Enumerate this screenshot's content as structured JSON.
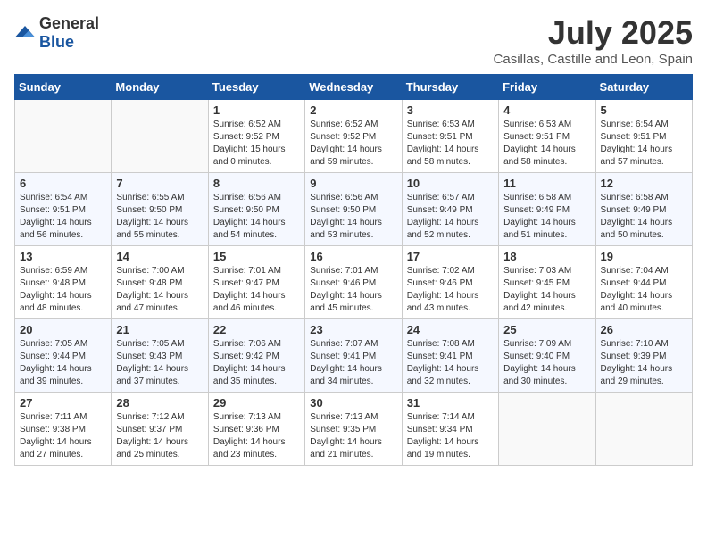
{
  "header": {
    "logo_general": "General",
    "logo_blue": "Blue",
    "month_title": "July 2025",
    "location": "Casillas, Castille and Leon, Spain"
  },
  "days_of_week": [
    "Sunday",
    "Monday",
    "Tuesday",
    "Wednesday",
    "Thursday",
    "Friday",
    "Saturday"
  ],
  "weeks": [
    [
      {
        "day": "",
        "info": ""
      },
      {
        "day": "",
        "info": ""
      },
      {
        "day": "1",
        "sunrise": "6:52 AM",
        "sunset": "9:52 PM",
        "daylight": "15 hours and 0 minutes."
      },
      {
        "day": "2",
        "sunrise": "6:52 AM",
        "sunset": "9:52 PM",
        "daylight": "14 hours and 59 minutes."
      },
      {
        "day": "3",
        "sunrise": "6:53 AM",
        "sunset": "9:51 PM",
        "daylight": "14 hours and 58 minutes."
      },
      {
        "day": "4",
        "sunrise": "6:53 AM",
        "sunset": "9:51 PM",
        "daylight": "14 hours and 58 minutes."
      },
      {
        "day": "5",
        "sunrise": "6:54 AM",
        "sunset": "9:51 PM",
        "daylight": "14 hours and 57 minutes."
      }
    ],
    [
      {
        "day": "6",
        "sunrise": "6:54 AM",
        "sunset": "9:51 PM",
        "daylight": "14 hours and 56 minutes."
      },
      {
        "day": "7",
        "sunrise": "6:55 AM",
        "sunset": "9:50 PM",
        "daylight": "14 hours and 55 minutes."
      },
      {
        "day": "8",
        "sunrise": "6:56 AM",
        "sunset": "9:50 PM",
        "daylight": "14 hours and 54 minutes."
      },
      {
        "day": "9",
        "sunrise": "6:56 AM",
        "sunset": "9:50 PM",
        "daylight": "14 hours and 53 minutes."
      },
      {
        "day": "10",
        "sunrise": "6:57 AM",
        "sunset": "9:49 PM",
        "daylight": "14 hours and 52 minutes."
      },
      {
        "day": "11",
        "sunrise": "6:58 AM",
        "sunset": "9:49 PM",
        "daylight": "14 hours and 51 minutes."
      },
      {
        "day": "12",
        "sunrise": "6:58 AM",
        "sunset": "9:49 PM",
        "daylight": "14 hours and 50 minutes."
      }
    ],
    [
      {
        "day": "13",
        "sunrise": "6:59 AM",
        "sunset": "9:48 PM",
        "daylight": "14 hours and 48 minutes."
      },
      {
        "day": "14",
        "sunrise": "7:00 AM",
        "sunset": "9:48 PM",
        "daylight": "14 hours and 47 minutes."
      },
      {
        "day": "15",
        "sunrise": "7:01 AM",
        "sunset": "9:47 PM",
        "daylight": "14 hours and 46 minutes."
      },
      {
        "day": "16",
        "sunrise": "7:01 AM",
        "sunset": "9:46 PM",
        "daylight": "14 hours and 45 minutes."
      },
      {
        "day": "17",
        "sunrise": "7:02 AM",
        "sunset": "9:46 PM",
        "daylight": "14 hours and 43 minutes."
      },
      {
        "day": "18",
        "sunrise": "7:03 AM",
        "sunset": "9:45 PM",
        "daylight": "14 hours and 42 minutes."
      },
      {
        "day": "19",
        "sunrise": "7:04 AM",
        "sunset": "9:44 PM",
        "daylight": "14 hours and 40 minutes."
      }
    ],
    [
      {
        "day": "20",
        "sunrise": "7:05 AM",
        "sunset": "9:44 PM",
        "daylight": "14 hours and 39 minutes."
      },
      {
        "day": "21",
        "sunrise": "7:05 AM",
        "sunset": "9:43 PM",
        "daylight": "14 hours and 37 minutes."
      },
      {
        "day": "22",
        "sunrise": "7:06 AM",
        "sunset": "9:42 PM",
        "daylight": "14 hours and 35 minutes."
      },
      {
        "day": "23",
        "sunrise": "7:07 AM",
        "sunset": "9:41 PM",
        "daylight": "14 hours and 34 minutes."
      },
      {
        "day": "24",
        "sunrise": "7:08 AM",
        "sunset": "9:41 PM",
        "daylight": "14 hours and 32 minutes."
      },
      {
        "day": "25",
        "sunrise": "7:09 AM",
        "sunset": "9:40 PM",
        "daylight": "14 hours and 30 minutes."
      },
      {
        "day": "26",
        "sunrise": "7:10 AM",
        "sunset": "9:39 PM",
        "daylight": "14 hours and 29 minutes."
      }
    ],
    [
      {
        "day": "27",
        "sunrise": "7:11 AM",
        "sunset": "9:38 PM",
        "daylight": "14 hours and 27 minutes."
      },
      {
        "day": "28",
        "sunrise": "7:12 AM",
        "sunset": "9:37 PM",
        "daylight": "14 hours and 25 minutes."
      },
      {
        "day": "29",
        "sunrise": "7:13 AM",
        "sunset": "9:36 PM",
        "daylight": "14 hours and 23 minutes."
      },
      {
        "day": "30",
        "sunrise": "7:13 AM",
        "sunset": "9:35 PM",
        "daylight": "14 hours and 21 minutes."
      },
      {
        "day": "31",
        "sunrise": "7:14 AM",
        "sunset": "9:34 PM",
        "daylight": "14 hours and 19 minutes."
      },
      {
        "day": "",
        "info": ""
      },
      {
        "day": "",
        "info": ""
      }
    ]
  ],
  "labels": {
    "sunrise": "Sunrise: ",
    "sunset": "Sunset: ",
    "daylight": "Daylight: "
  }
}
